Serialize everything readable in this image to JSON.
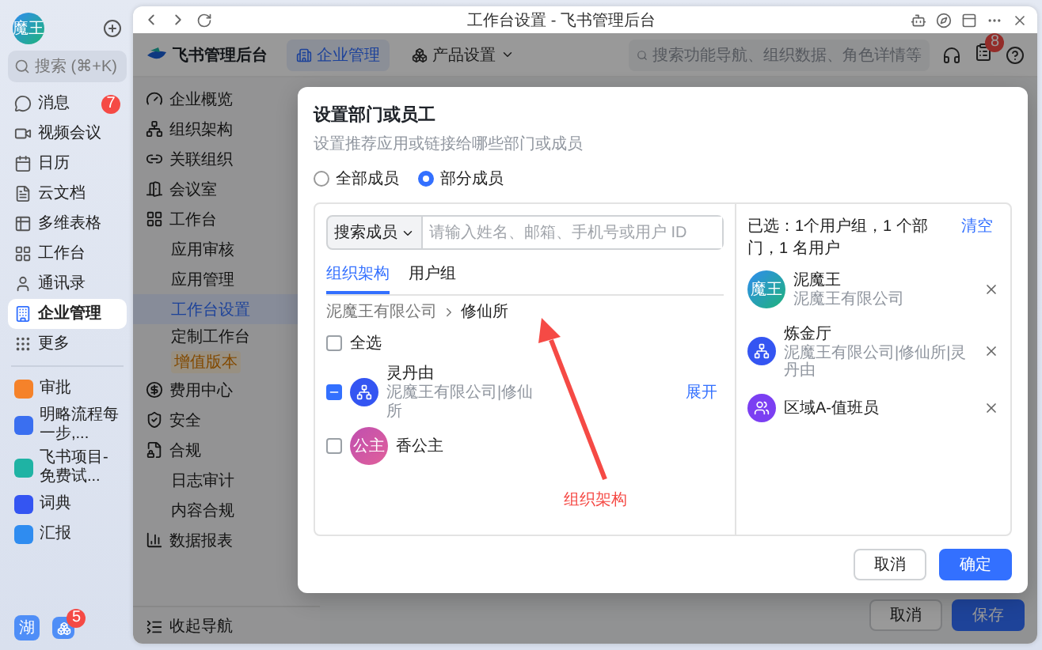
{
  "app_sidebar": {
    "avatar": "魔王",
    "search": {
      "placeholder": "搜索 (⌘+K)"
    },
    "items": [
      {
        "label": "消息",
        "selected": false,
        "badge": "7"
      },
      {
        "label": "视频会议",
        "selected": false
      },
      {
        "label": "日历",
        "selected": false
      },
      {
        "label": "云文档",
        "selected": false
      },
      {
        "label": "多维表格",
        "selected": false
      },
      {
        "label": "工作台",
        "selected": false
      },
      {
        "label": "通讯录",
        "selected": false
      },
      {
        "label": "企业管理",
        "selected": true
      },
      {
        "label": "更多",
        "selected": false
      }
    ],
    "apps": [
      {
        "label": "审批",
        "color": "#f5822a"
      },
      {
        "label": "明略流程每一步,...",
        "color": "#3a6ff0"
      },
      {
        "label": "飞书项目-免费试...",
        "color": "#1fb3a4"
      },
      {
        "label": "词典",
        "color": "#3455f2"
      },
      {
        "label": "汇报",
        "color": "#2f8cf0"
      }
    ],
    "bottom": {
      "avatar": "湖",
      "badge": "5"
    }
  },
  "window": {
    "title": "工作台设置 - 飞书管理后台"
  },
  "header": {
    "logo": "飞书管理后台",
    "tabs": [
      {
        "label": "企业管理",
        "selected": true
      },
      {
        "label": "产品设置",
        "selected": false
      }
    ],
    "search": {
      "placeholder": "搜索功能导航、组织数据、角色详情等"
    },
    "notification_badge": "8"
  },
  "nav": {
    "items": [
      {
        "label": "企业概览",
        "selected": false
      },
      {
        "label": "组织架构",
        "selected": false
      },
      {
        "label": "关联组织",
        "selected": false
      },
      {
        "label": "会议室",
        "selected": false
      },
      {
        "label": "工作台",
        "selected": false,
        "children": [
          {
            "label": "应用审核",
            "selected": false
          },
          {
            "label": "应用管理",
            "selected": false
          },
          {
            "label": "工作台设置",
            "selected": true
          },
          {
            "label": "定制工作台",
            "selected": false,
            "badge": "增值版本"
          }
        ]
      },
      {
        "label": "费用中心",
        "selected": false
      },
      {
        "label": "安全",
        "selected": false
      },
      {
        "label": "合规",
        "selected": false,
        "children": [
          {
            "label": "日志审计",
            "selected": false
          },
          {
            "label": "内容合规",
            "selected": false
          }
        ]
      },
      {
        "label": "数据报表",
        "selected": false
      }
    ],
    "collapse": "收起导航"
  },
  "page_actions": [
    {
      "label": "取消",
      "kind": "secondary"
    },
    {
      "label": "保存",
      "kind": "primary"
    }
  ],
  "dialog": {
    "title": "设置部门或员工",
    "subtitle": "设置推荐应用或链接给哪些部门或成员",
    "scope": [
      {
        "label": "全部成员",
        "selected": false
      },
      {
        "label": "部分成员",
        "selected": true
      }
    ],
    "search": {
      "mode": "搜索成员",
      "placeholder": "请输入姓名、邮箱、手机号或用户 ID"
    },
    "tabs": [
      {
        "label": "组织架构",
        "selected": true
      },
      {
        "label": "用户组",
        "selected": false
      }
    ],
    "breadcrumb": [
      "泥魔王有限公司",
      "修仙所"
    ],
    "select_all": {
      "label": "全选",
      "checked": false
    },
    "members": [
      {
        "kind": "department",
        "name": "灵丹由",
        "detail": "泥魔王有限公司|修仙所",
        "checked": true,
        "partial": true,
        "action": "展开"
      },
      {
        "kind": "user",
        "name": "香公主",
        "avatar": "公主",
        "checked": false
      }
    ],
    "annotation": "组织架构",
    "selected_summary": "已选：1个用户组，1 个部门，1 名用户",
    "clear": "清空",
    "selected": [
      {
        "kind": "user",
        "name": "泥魔王",
        "detail": "泥魔王有限公司",
        "avatar": "魔王"
      },
      {
        "kind": "department",
        "name": "炼金厅",
        "detail": "泥魔王有限公司|修仙所|灵丹由"
      },
      {
        "kind": "group",
        "name": "区域A-值班员"
      }
    ],
    "buttons": [
      {
        "label": "取消",
        "kind": "secondary"
      },
      {
        "label": "确定",
        "kind": "primary"
      }
    ]
  }
}
